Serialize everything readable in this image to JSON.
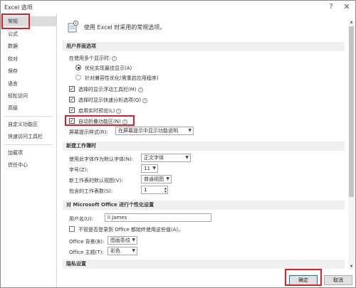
{
  "window": {
    "title": "Excel 选项",
    "help_label": "?",
    "close_label": "✕"
  },
  "sidebar": {
    "items": [
      {
        "label": "常规",
        "active": true
      },
      {
        "label": "公式"
      },
      {
        "label": "数据"
      },
      {
        "label": "校对"
      },
      {
        "label": "保存"
      },
      {
        "label": "语言"
      },
      {
        "label": "轻松访问"
      },
      {
        "label": "高级"
      },
      {
        "label": "自定义功能区"
      },
      {
        "label": "快速访问工具栏"
      },
      {
        "label": "加载项"
      },
      {
        "label": "信任中心"
      }
    ]
  },
  "intro": {
    "text": "使用 Excel 时采用的常规选项。"
  },
  "ui_options": {
    "section": "用户界面选项",
    "multi_display_label": "在使用多个显示时:",
    "radio_optimize": "优化实现最佳显示(A)",
    "radio_compat": "针对兼容性优化(需重启应用程序)",
    "chk_mini_toolbar": "选择时显示浮动工具栏(M)",
    "chk_quick_analysis": "选择时显示快速分析选项(Q)",
    "chk_live_preview": "启用实时预览(L)",
    "chk_collapse_ribbon": "自动折叠功能区(N)",
    "screentip_label": "屏幕提示样式(R):",
    "screentip_value": "在屏幕提示中显示功能说明"
  },
  "new_workbook": {
    "section": "新建工作簿时",
    "font_label": "使用此字体作为默认字体(N):",
    "font_value": "正文字体",
    "size_label": "字号(Z):",
    "size_value": "11",
    "view_label": "新工作表的默认视图(V):",
    "view_value": "普通视图",
    "sheets_label": "包含的工作表数(S):",
    "sheets_value": "1"
  },
  "personalize": {
    "section": "对 Microsoft Office 进行个性化设置",
    "username_label": "用户名(U):",
    "username_value": "li James",
    "chk_always_use": "不管是否登录到 Office 都始终使用这些值(A)。",
    "background_label": "Office 背景(B):",
    "background_value": "图画条纹",
    "theme_label": "Office 主题(T):",
    "theme_value": "彩色"
  },
  "privacy": {
    "section": "隐私设置"
  },
  "buttons": {
    "ok": "确定",
    "cancel": "取消"
  },
  "colors": {
    "highlight": "#e01e24",
    "accent": "#0078d7"
  }
}
